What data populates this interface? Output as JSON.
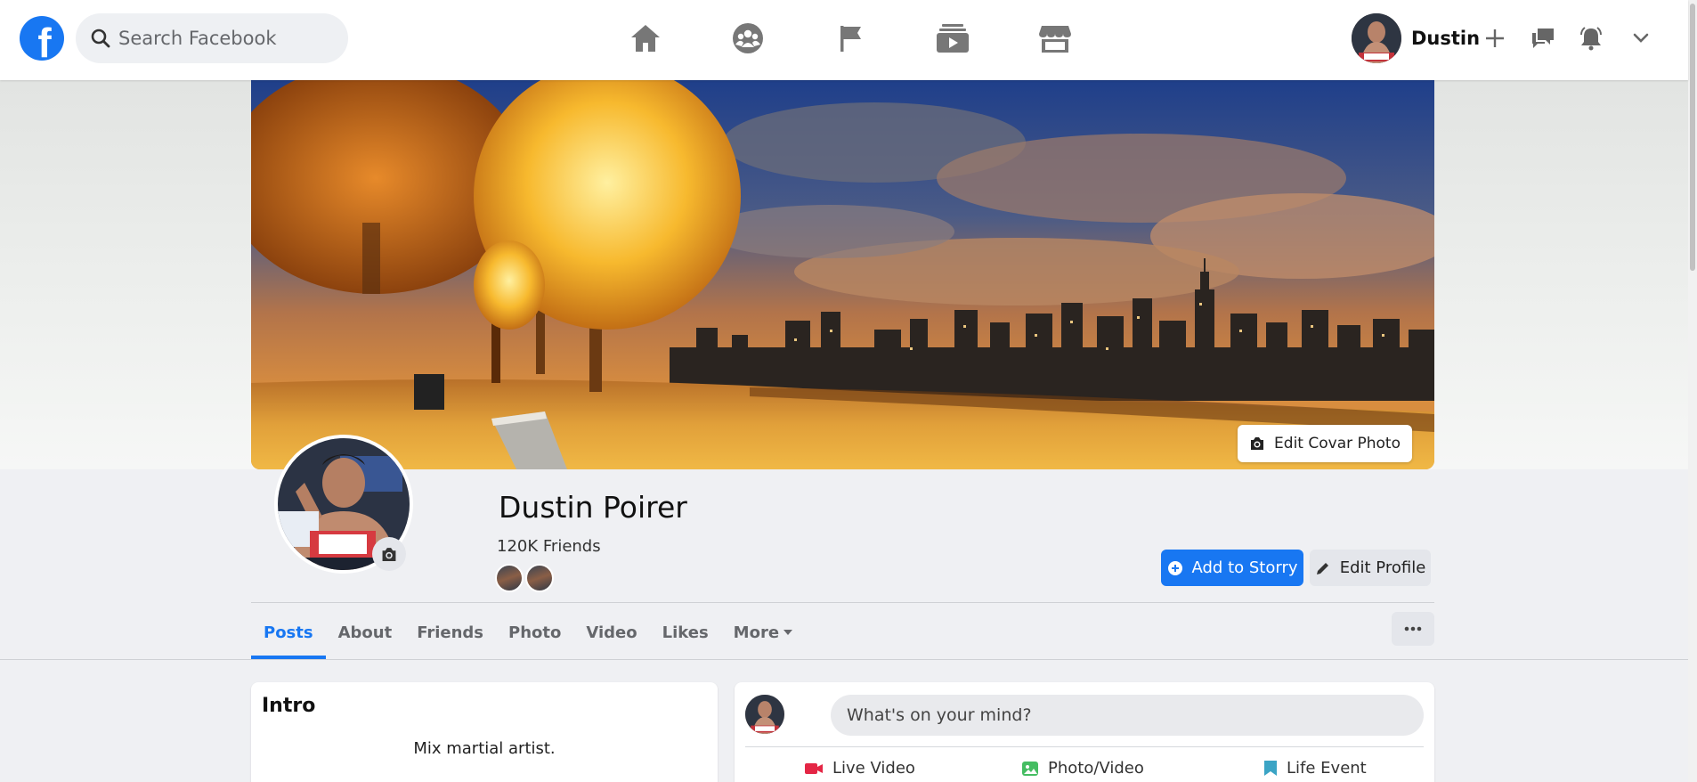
{
  "header": {
    "logo_letter": "f",
    "search_placeholder": "Search Facebook",
    "nav_icons": [
      "home-icon",
      "groups-icon",
      "pages-flag-icon",
      "watch-icon",
      "marketplace-icon"
    ],
    "user_first_name": "Dustin",
    "right_icons": [
      "plus-icon",
      "messenger-icon",
      "notifications-bell-icon",
      "account-menu-chevron-icon"
    ]
  },
  "cover": {
    "edit_cover_label": "Edit Covar Photo"
  },
  "profile": {
    "full_name": "Dustin Poirer",
    "friends_count": "120K Friends",
    "add_story_label": "Add to Storry",
    "edit_profile_label": "Edit Profile"
  },
  "tabs": {
    "items": [
      "Posts",
      "About",
      "Friends",
      "Photo",
      "Video",
      "Likes",
      "More"
    ],
    "active": "Posts"
  },
  "intro": {
    "title": "Intro",
    "bio": "Mix martial artist."
  },
  "composer": {
    "placeholder": "What's on your mind?",
    "actions": [
      "Live Video",
      "Photo/Video",
      "Life Event"
    ]
  },
  "colors": {
    "brand": "#1877f2",
    "page_bg": "#eff0f3",
    "live_video": "#e42645",
    "photo_video": "#45bd62",
    "life_event": "#3ba4c5"
  }
}
